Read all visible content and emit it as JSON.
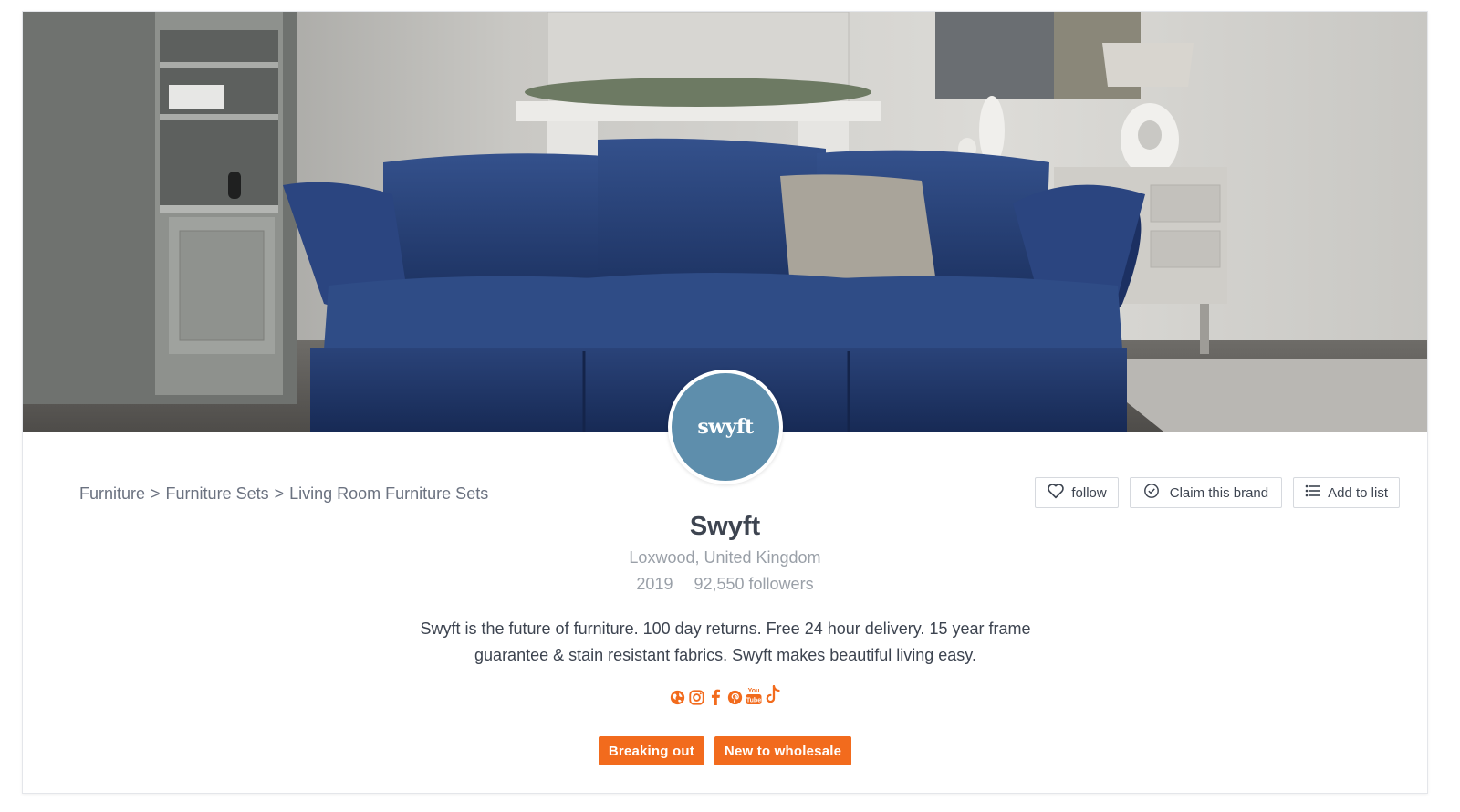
{
  "brand": {
    "name": "Swyft",
    "logo_text": "swyft",
    "location": "Loxwood, United Kingdom",
    "founded": "2019",
    "followers": "92,550 followers",
    "description": "Swyft is the future of furniture. 100 day returns. Free 24 hour delivery. 15 year frame guarantee & stain resistant fabrics. Swyft makes beautiful living easy."
  },
  "breadcrumb": {
    "items": [
      "Furniture",
      "Furniture Sets",
      "Living Room Furniture Sets"
    ],
    "separator": ">"
  },
  "actions": {
    "follow_label": "follow",
    "claim_label": "Claim this brand",
    "add_to_list_label": "Add to list"
  },
  "socials": [
    {
      "icon": "globe-icon"
    },
    {
      "icon": "instagram-icon"
    },
    {
      "icon": "facebook-icon"
    },
    {
      "icon": "pinterest-icon"
    },
    {
      "icon": "youtube-icon",
      "text": "You Tube"
    },
    {
      "icon": "tiktok-icon"
    }
  ],
  "tags": [
    "Breaking out",
    "New to wholesale"
  ],
  "colors": {
    "accent": "#f26b1d",
    "logo_bg": "#5e8eac",
    "sofa": "#1f3566"
  }
}
